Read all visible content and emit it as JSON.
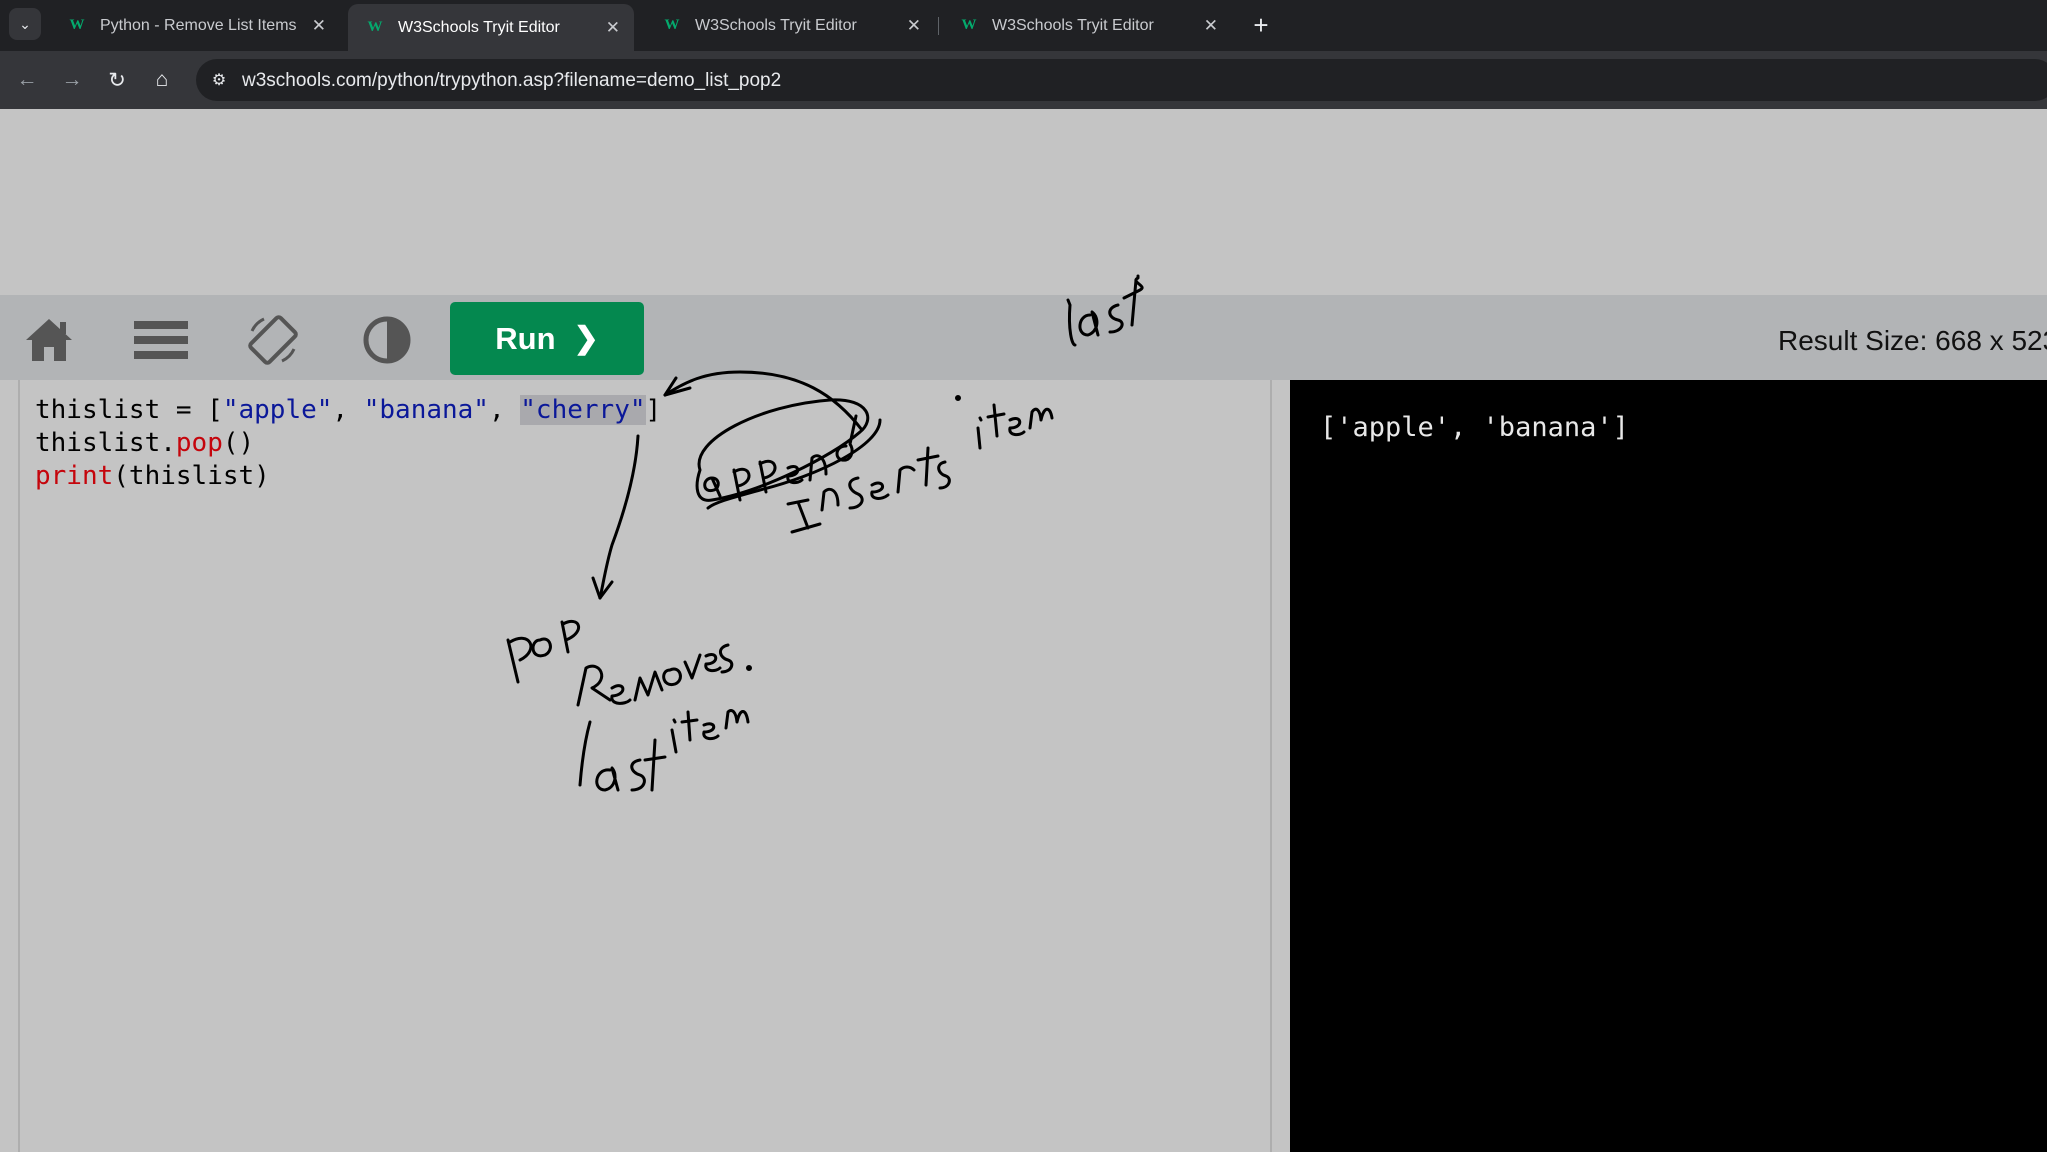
{
  "browser": {
    "tabs": [
      {
        "favicon": "w3schools-icon",
        "title": "Python - Remove List Items",
        "active": false
      },
      {
        "favicon": "w3schools-icon",
        "title": "W3Schools Tryit Editor",
        "active": true
      },
      {
        "favicon": "w3schools-icon",
        "title": "W3Schools Tryit Editor",
        "active": false
      },
      {
        "favicon": "w3schools-icon",
        "title": "W3Schools Tryit Editor",
        "active": false
      }
    ],
    "new_tab_label": "+",
    "url": "w3schools.com/python/trypython.asp?filename=demo_list_pop2"
  },
  "editor": {
    "run_label": "Run",
    "result_size": "Result Size: 668 x 523",
    "code": {
      "line1": {
        "a": "thislist = [",
        "s1": "\"apple\"",
        "c1": ", ",
        "s2": "\"banana\"",
        "c2": ", ",
        "s3": "\"cherry\"",
        "end": "]"
      },
      "line2": {
        "a": "thislist.",
        "fn": "pop",
        "end": "()"
      },
      "line3": {
        "fn": "print",
        "end": "(thislist)"
      }
    },
    "result": "['apple', 'banana']"
  },
  "colors": {
    "run_button": "#04884f",
    "string": "#0b1899",
    "keyword_fn": "#c5050c"
  }
}
